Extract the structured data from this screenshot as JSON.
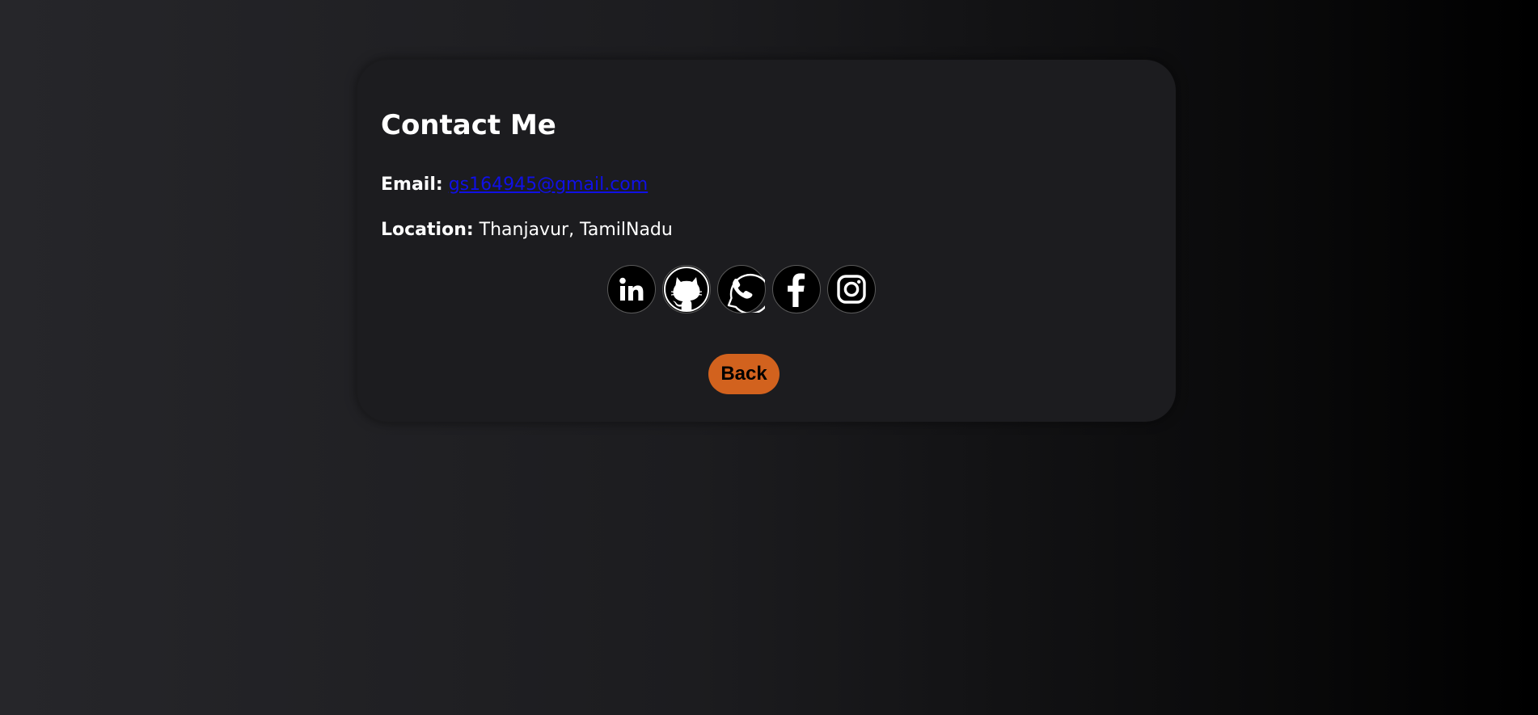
{
  "contact": {
    "title": "Contact Me",
    "email_label": "Email:",
    "email_value": "gs164945@gmail.com",
    "location_label": "Location:",
    "location_value": "Thanjavur, TamilNadu"
  },
  "socials": [
    {
      "icon": "linkedin-icon"
    },
    {
      "icon": "github-icon"
    },
    {
      "icon": "whatsapp-icon"
    },
    {
      "icon": "facebook-icon"
    },
    {
      "icon": "instagram-icon"
    }
  ],
  "back_button": {
    "label": "Back"
  },
  "colors": {
    "accent": "#d2621e",
    "link": "#1010e6",
    "card": "#1c1c1f",
    "text": "#ffffff"
  }
}
